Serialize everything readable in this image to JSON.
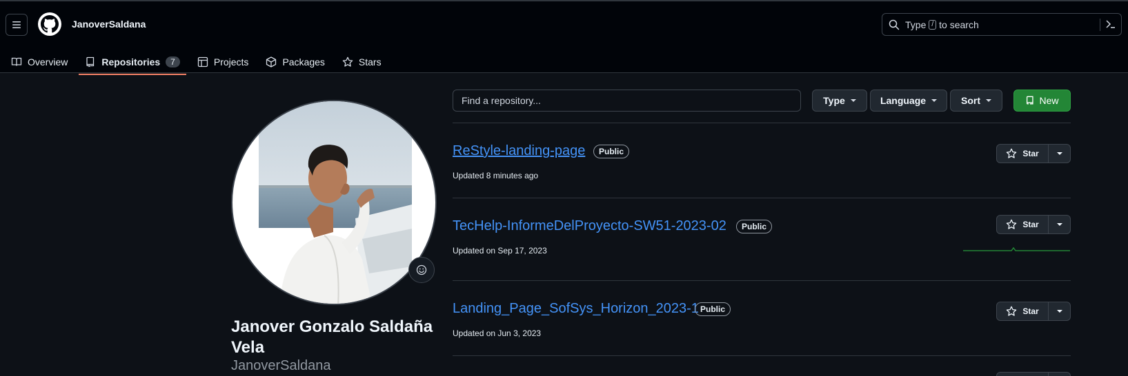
{
  "header": {
    "username": "JanoverSaldana",
    "search_prefix": "Type",
    "search_key": "/",
    "search_suffix": "to search"
  },
  "tabs": [
    {
      "label": "Overview",
      "icon": "book-icon"
    },
    {
      "label": "Repositories",
      "icon": "repo-icon",
      "count": "7",
      "active": true
    },
    {
      "label": "Projects",
      "icon": "table-icon"
    },
    {
      "label": "Packages",
      "icon": "package-icon"
    },
    {
      "label": "Stars",
      "icon": "star-icon"
    }
  ],
  "profile": {
    "full_name": "Janover Gonzalo Saldaña Vela",
    "login": "JanoverSaldana"
  },
  "filters": {
    "search_placeholder": "Find a repository...",
    "type_label": "Type",
    "language_label": "Language",
    "sort_label": "Sort",
    "new_label": "New"
  },
  "repos": [
    {
      "name": "ReStyle-landing-page",
      "visibility": "Public",
      "updated": "Updated 8 minutes ago",
      "star_label": "Star"
    },
    {
      "name": "TecHelp-InformeDelProyecto-SW51-2023-02",
      "visibility": "Public",
      "updated": "Updated on Sep 17, 2023",
      "star_label": "Star"
    },
    {
      "name": "Landing_Page_SofSys_Horizon_2023-1",
      "visibility": "Public",
      "updated": "Updated on Jun 3, 2023",
      "star_label": "Star"
    }
  ],
  "colors": {
    "background": "#0d1117",
    "header_bg": "#010409",
    "link": "#4493f8",
    "accent_tab": "#f78166",
    "new_button": "#238636",
    "sparkline": "#238636"
  }
}
